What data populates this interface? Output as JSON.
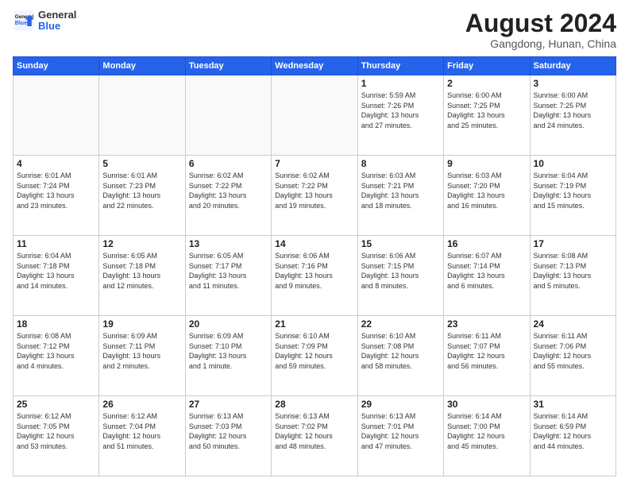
{
  "logo": {
    "general": "General",
    "blue": "Blue"
  },
  "header": {
    "month": "August 2024",
    "location": "Gangdong, Hunan, China"
  },
  "days_of_week": [
    "Sunday",
    "Monday",
    "Tuesday",
    "Wednesday",
    "Thursday",
    "Friday",
    "Saturday"
  ],
  "weeks": [
    [
      {
        "day": "",
        "info": ""
      },
      {
        "day": "",
        "info": ""
      },
      {
        "day": "",
        "info": ""
      },
      {
        "day": "",
        "info": ""
      },
      {
        "day": "1",
        "info": "Sunrise: 5:59 AM\nSunset: 7:26 PM\nDaylight: 13 hours\nand 27 minutes."
      },
      {
        "day": "2",
        "info": "Sunrise: 6:00 AM\nSunset: 7:25 PM\nDaylight: 13 hours\nand 25 minutes."
      },
      {
        "day": "3",
        "info": "Sunrise: 6:00 AM\nSunset: 7:25 PM\nDaylight: 13 hours\nand 24 minutes."
      }
    ],
    [
      {
        "day": "4",
        "info": "Sunrise: 6:01 AM\nSunset: 7:24 PM\nDaylight: 13 hours\nand 23 minutes."
      },
      {
        "day": "5",
        "info": "Sunrise: 6:01 AM\nSunset: 7:23 PM\nDaylight: 13 hours\nand 22 minutes."
      },
      {
        "day": "6",
        "info": "Sunrise: 6:02 AM\nSunset: 7:22 PM\nDaylight: 13 hours\nand 20 minutes."
      },
      {
        "day": "7",
        "info": "Sunrise: 6:02 AM\nSunset: 7:22 PM\nDaylight: 13 hours\nand 19 minutes."
      },
      {
        "day": "8",
        "info": "Sunrise: 6:03 AM\nSunset: 7:21 PM\nDaylight: 13 hours\nand 18 minutes."
      },
      {
        "day": "9",
        "info": "Sunrise: 6:03 AM\nSunset: 7:20 PM\nDaylight: 13 hours\nand 16 minutes."
      },
      {
        "day": "10",
        "info": "Sunrise: 6:04 AM\nSunset: 7:19 PM\nDaylight: 13 hours\nand 15 minutes."
      }
    ],
    [
      {
        "day": "11",
        "info": "Sunrise: 6:04 AM\nSunset: 7:18 PM\nDaylight: 13 hours\nand 14 minutes."
      },
      {
        "day": "12",
        "info": "Sunrise: 6:05 AM\nSunset: 7:18 PM\nDaylight: 13 hours\nand 12 minutes."
      },
      {
        "day": "13",
        "info": "Sunrise: 6:05 AM\nSunset: 7:17 PM\nDaylight: 13 hours\nand 11 minutes."
      },
      {
        "day": "14",
        "info": "Sunrise: 6:06 AM\nSunset: 7:16 PM\nDaylight: 13 hours\nand 9 minutes."
      },
      {
        "day": "15",
        "info": "Sunrise: 6:06 AM\nSunset: 7:15 PM\nDaylight: 13 hours\nand 8 minutes."
      },
      {
        "day": "16",
        "info": "Sunrise: 6:07 AM\nSunset: 7:14 PM\nDaylight: 13 hours\nand 6 minutes."
      },
      {
        "day": "17",
        "info": "Sunrise: 6:08 AM\nSunset: 7:13 PM\nDaylight: 13 hours\nand 5 minutes."
      }
    ],
    [
      {
        "day": "18",
        "info": "Sunrise: 6:08 AM\nSunset: 7:12 PM\nDaylight: 13 hours\nand 4 minutes."
      },
      {
        "day": "19",
        "info": "Sunrise: 6:09 AM\nSunset: 7:11 PM\nDaylight: 13 hours\nand 2 minutes."
      },
      {
        "day": "20",
        "info": "Sunrise: 6:09 AM\nSunset: 7:10 PM\nDaylight: 13 hours\nand 1 minute."
      },
      {
        "day": "21",
        "info": "Sunrise: 6:10 AM\nSunset: 7:09 PM\nDaylight: 12 hours\nand 59 minutes."
      },
      {
        "day": "22",
        "info": "Sunrise: 6:10 AM\nSunset: 7:08 PM\nDaylight: 12 hours\nand 58 minutes."
      },
      {
        "day": "23",
        "info": "Sunrise: 6:11 AM\nSunset: 7:07 PM\nDaylight: 12 hours\nand 56 minutes."
      },
      {
        "day": "24",
        "info": "Sunrise: 6:11 AM\nSunset: 7:06 PM\nDaylight: 12 hours\nand 55 minutes."
      }
    ],
    [
      {
        "day": "25",
        "info": "Sunrise: 6:12 AM\nSunset: 7:05 PM\nDaylight: 12 hours\nand 53 minutes."
      },
      {
        "day": "26",
        "info": "Sunrise: 6:12 AM\nSunset: 7:04 PM\nDaylight: 12 hours\nand 51 minutes."
      },
      {
        "day": "27",
        "info": "Sunrise: 6:13 AM\nSunset: 7:03 PM\nDaylight: 12 hours\nand 50 minutes."
      },
      {
        "day": "28",
        "info": "Sunrise: 6:13 AM\nSunset: 7:02 PM\nDaylight: 12 hours\nand 48 minutes."
      },
      {
        "day": "29",
        "info": "Sunrise: 6:13 AM\nSunset: 7:01 PM\nDaylight: 12 hours\nand 47 minutes."
      },
      {
        "day": "30",
        "info": "Sunrise: 6:14 AM\nSunset: 7:00 PM\nDaylight: 12 hours\nand 45 minutes."
      },
      {
        "day": "31",
        "info": "Sunrise: 6:14 AM\nSunset: 6:59 PM\nDaylight: 12 hours\nand 44 minutes."
      }
    ]
  ]
}
